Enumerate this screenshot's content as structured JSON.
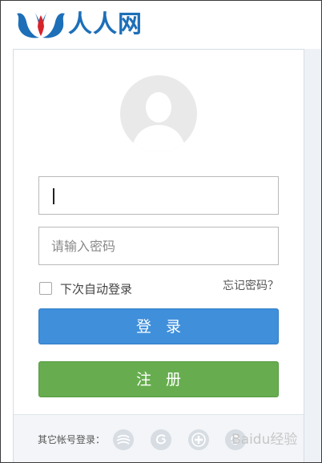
{
  "brand": {
    "name": "人人网",
    "color": "#1d6fb8"
  },
  "login": {
    "username_value": "",
    "password_placeholder": "请输入密码",
    "remember_label": "下次自动登录",
    "forgot_label": "忘记密码？",
    "login_button": "登录",
    "register_button": "注册"
  },
  "footer": {
    "other_login_label": "其它帐号登录：",
    "icons": [
      "china-mobile-icon",
      "tianyi-icon",
      "plus-icon",
      "extra-login-icon"
    ]
  },
  "watermark": "Baidu经验",
  "colors": {
    "login": "#3f8fdb",
    "register": "#67ad4f"
  }
}
